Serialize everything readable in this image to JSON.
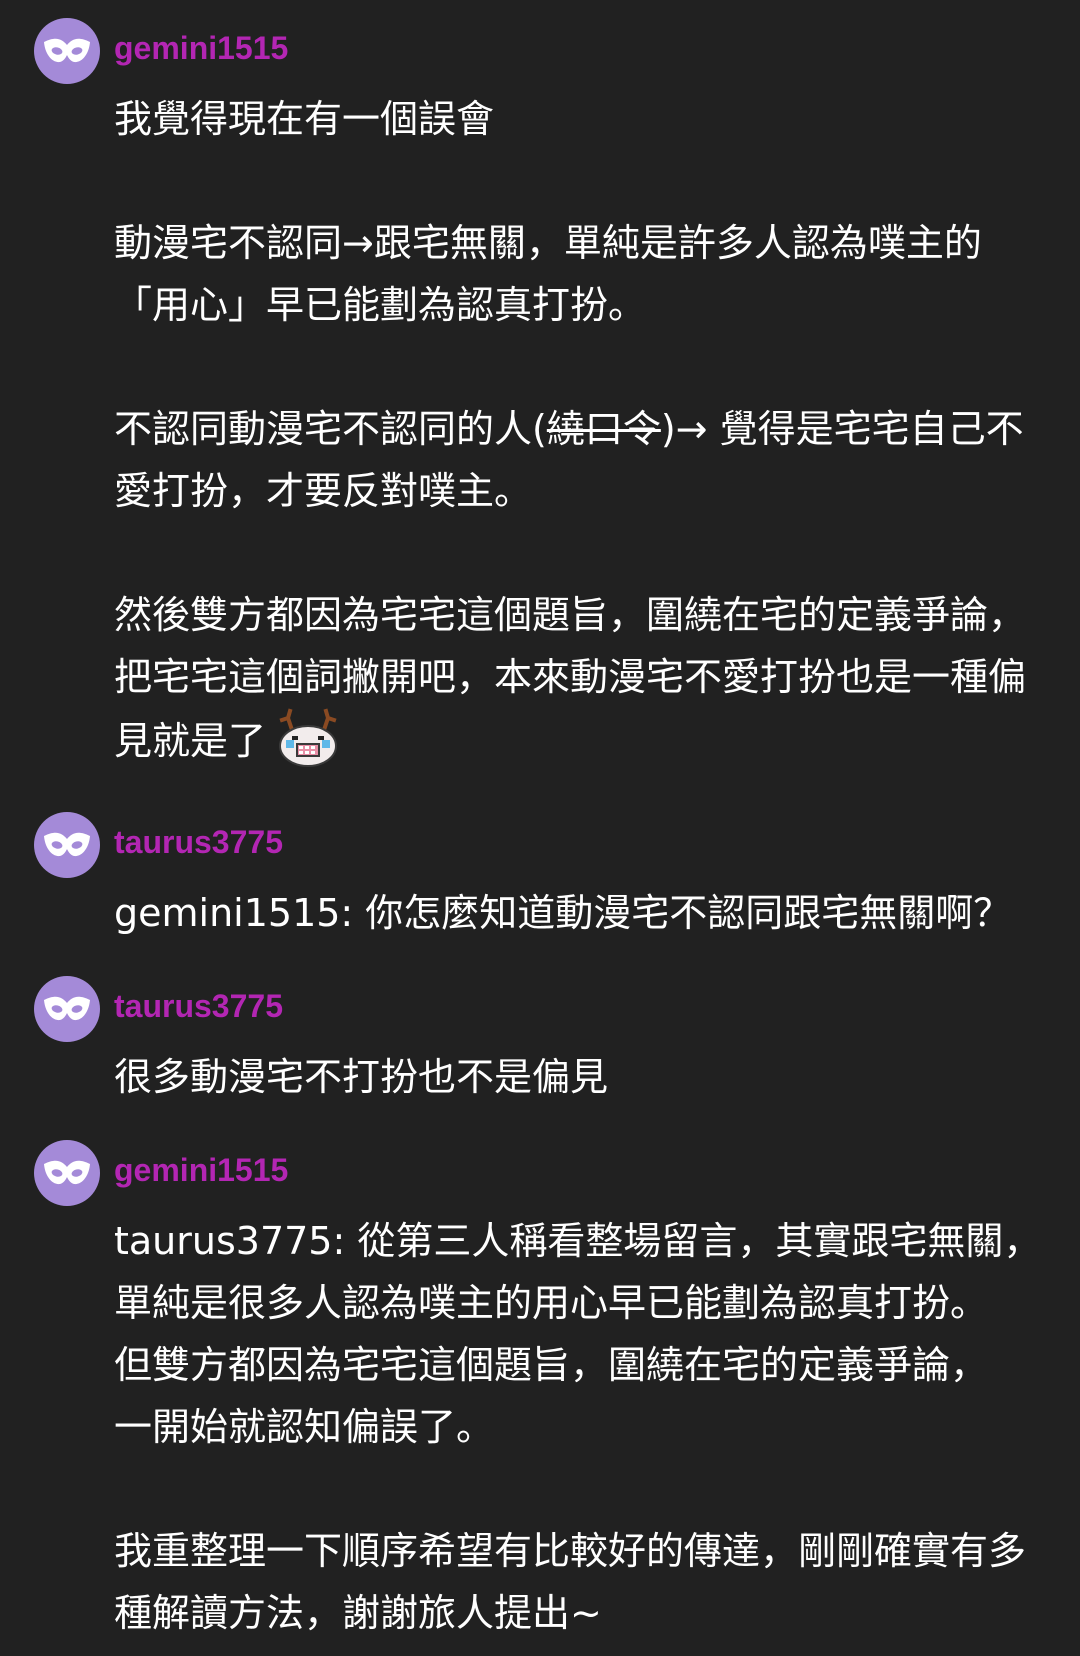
{
  "colors": {
    "background": "#212121",
    "username": "#b326b3",
    "avatar": "#a48ad8",
    "text": "#ffffff"
  },
  "comments": [
    {
      "username": "gemini1515",
      "avatar_icon": "masquerade-mask-icon",
      "paragraphs": [
        "我覺得現在有一個誤會",
        "動漫宅不認同→跟宅無關，單純是許多人認為噗主的「用心」早已能劃為認真打扮。",
        {
          "before": "不認同動漫宅不認同的人(",
          "strikethrough": "繞口令",
          "after": ")→ 覺得是宅宅自己不愛打扮，才要反對噗主。"
        },
        "然後雙方都因為宅宅這個題旨，圍繞在宅的定義爭論，把宅宅這個詞撇開吧，本來動漫宅不愛打扮也是一種偏見就是了"
      ],
      "sticker_icon": "crying-reindeer-sticker-icon"
    },
    {
      "username": "taurus3775",
      "avatar_icon": "masquerade-mask-icon",
      "paragraphs": [
        "gemini1515: 你怎麼知道動漫宅不認同跟宅無關啊？"
      ]
    },
    {
      "username": "taurus3775",
      "avatar_icon": "masquerade-mask-icon",
      "paragraphs": [
        "很多動漫宅不打扮也不是偏見"
      ]
    },
    {
      "username": "gemini1515",
      "avatar_icon": "masquerade-mask-icon",
      "paragraphs": [
        "taurus3775: 從第三人稱看整場留言，其實跟宅無關，\n單純是很多人認為噗主的用心早已能劃為認真打扮。\n但雙方都因為宅宅這個題旨，圍繞在宅的定義爭論，\n一開始就認知偏誤了。",
        "我重整理一下順序希望有比較好的傳達，剛剛確實有多種解讀方法，謝謝旅人提出~"
      ]
    }
  ]
}
